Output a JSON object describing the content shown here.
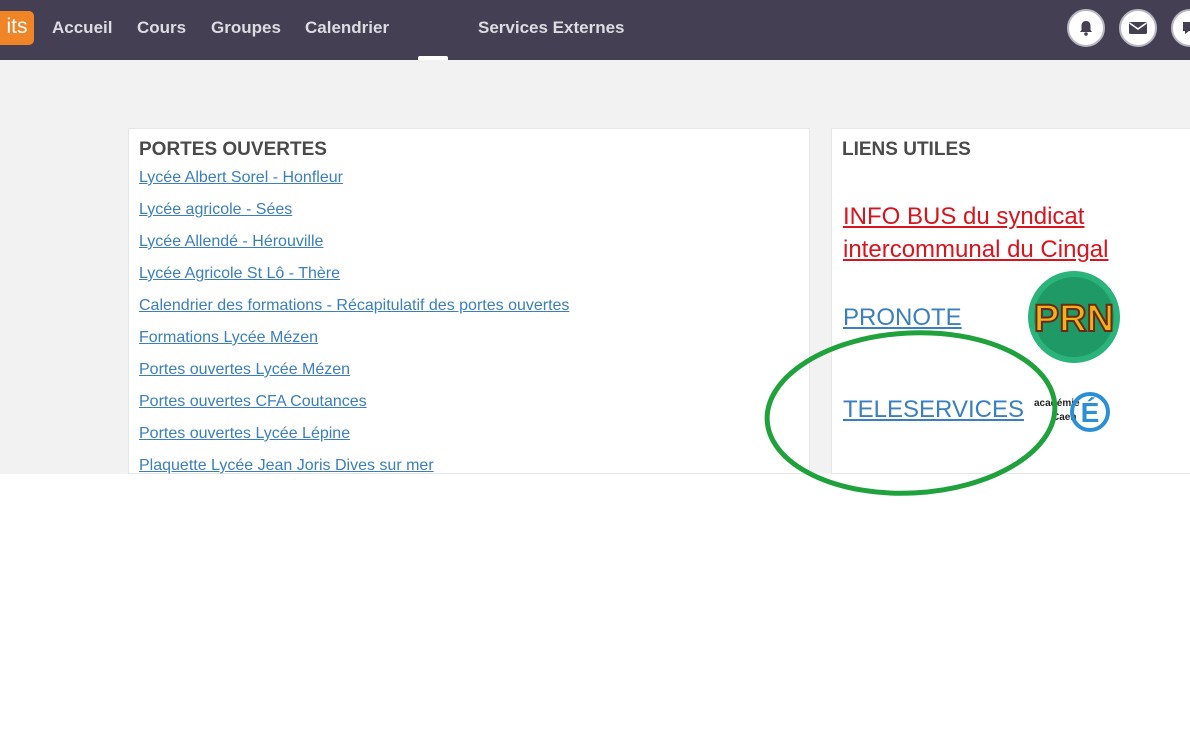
{
  "header": {
    "logo_text": "its",
    "nav": {
      "accueil": "Accueil",
      "cours": "Cours",
      "groupes": "Groupes",
      "calendrier": "Calendrier",
      "services": "Services Externes"
    }
  },
  "portes_ouvertes": {
    "title": "PORTES OUVERTES",
    "links": [
      "Lycée Albert Sorel - Honfleur",
      "Lycée agricole - Sées",
      "Lycée Allendé - Hérouville",
      "Lycée Agricole St Lô - Thère",
      "Calendrier des formations - Récapitulatif des portes ouvertes",
      "Formations Lycée Mézen",
      "Portes ouvertes Lycée Mézen",
      "Portes ouvertes CFA Coutances",
      "Portes ouvertes Lycée Lépine",
      "Plaquette Lycée Jean Joris Dives sur mer"
    ]
  },
  "liens_utiles": {
    "title": "LIENS UTILES",
    "infobus": "INFO BUS du syndicat intercommunal du Cingal",
    "pronote": "PRONOTE",
    "teleservices": "TELESERVICES",
    "prn_logo_text": "PRN",
    "academie_text_1": "académie",
    "academie_text_2": "Caen",
    "academie_letter": "É"
  },
  "colors": {
    "topbar": "#443f52",
    "logo": "#f08527",
    "link": "#3a7fbf",
    "infobus": "#d9141c",
    "annotation": "#1fa23c"
  },
  "icons": [
    "bell-icon",
    "mail-icon",
    "chat-icon"
  ]
}
